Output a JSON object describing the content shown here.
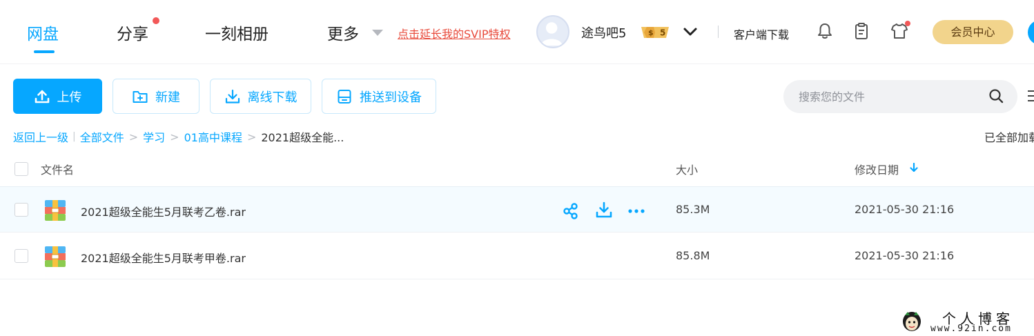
{
  "header": {
    "nav": [
      {
        "label": "网盘",
        "active": true
      },
      {
        "label": "分享",
        "dot": true
      },
      {
        "label": "一刻相册"
      },
      {
        "label": "更多"
      }
    ],
    "svip_link": "点击延长我的SVIP特权",
    "username": "途鸟吧5",
    "badge": "5",
    "client_download": "客户端下载",
    "vip_center": "会员中心"
  },
  "toolbar": {
    "upload": "上传",
    "new": "新建",
    "offline_download": "离线下载",
    "push_to_device": "推送到设备"
  },
  "search": {
    "placeholder": "搜索您的文件"
  },
  "breadcrumb": {
    "back": "返回上一级",
    "items": [
      "全部文件",
      "学习",
      "01高中课程"
    ],
    "current": "2021超级全能..."
  },
  "status": {
    "loaded": "已全部加载"
  },
  "table": {
    "columns": {
      "name": "文件名",
      "size": "大小",
      "modified": "修改日期"
    },
    "rows": [
      {
        "name": "2021超级全能生5月联考乙卷.rar",
        "size": "85.3M",
        "modified": "2021-05-30 21:16"
      },
      {
        "name": "2021超级全能生5月联考甲卷.rar",
        "size": "85.8M",
        "modified": "2021-05-30 21:16"
      }
    ]
  },
  "watermark": {
    "title": "个人博客",
    "url": "www.92in.com"
  },
  "colors": {
    "accent": "#06a7ff",
    "svip": "#e84a3b",
    "vip_button": "#f2d48c",
    "notify_dot": "#f25858"
  }
}
